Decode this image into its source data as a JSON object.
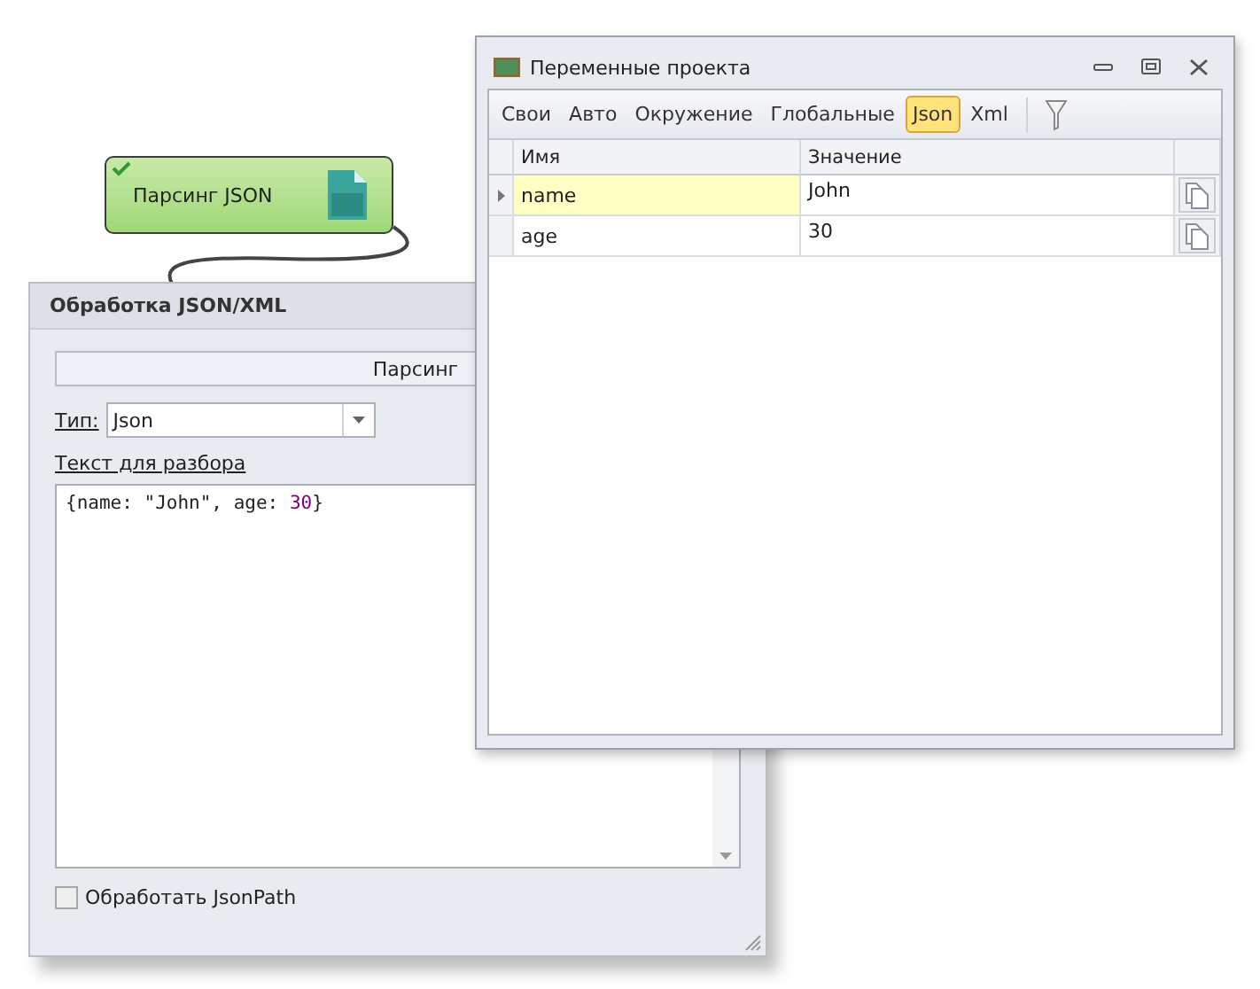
{
  "node": {
    "title": "Парсинг JSON",
    "completed": true
  },
  "panel": {
    "title": "Обработка JSON/XML",
    "section": "Парсинг",
    "type_label": "Тип:",
    "type_value": "Json",
    "text_label": "Текст для разбора",
    "code": [
      {
        "text": "{name: \"John\", age: ",
        "kind": "plain"
      },
      {
        "text": "30",
        "kind": "number"
      },
      {
        "text": "}",
        "kind": "plain"
      }
    ],
    "jsonpath": {
      "label": "Обработать JsonPath",
      "checked": false
    }
  },
  "window": {
    "title": "Переменные проекта",
    "tabs": [
      {
        "label": "Свои",
        "selected": false
      },
      {
        "label": "Авто",
        "selected": false
      },
      {
        "label": "Окружение",
        "selected": false
      },
      {
        "label": "Глобальные",
        "selected": false
      },
      {
        "label": "Json",
        "selected": true
      },
      {
        "label": "Xml",
        "selected": false
      }
    ],
    "columns": [
      "Имя",
      "Значение"
    ],
    "rows": [
      {
        "name": "name",
        "value": "John",
        "selected": true
      },
      {
        "name": "age",
        "value": "30",
        "selected": false
      }
    ]
  }
}
